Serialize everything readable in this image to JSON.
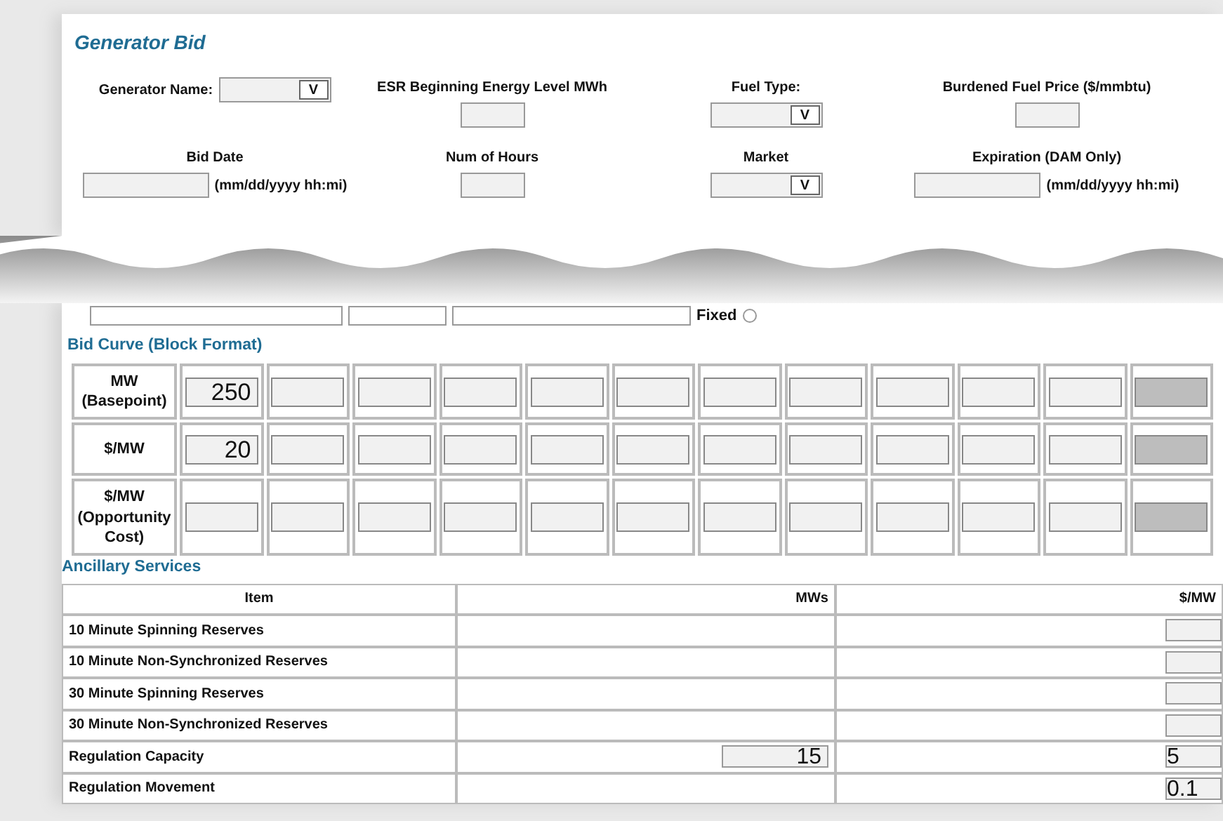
{
  "title": "Generator Bid",
  "field_rows": [
    [
      {
        "label": "Generator Name:",
        "kind": "inline-select",
        "button": "V"
      },
      {
        "label": "ESR Beginning Energy Level MWh",
        "kind": "text"
      },
      {
        "label": "Fuel Type:",
        "kind": "select",
        "button": "V"
      },
      {
        "label": "Burdened Fuel Price ($/mmbtu)",
        "kind": "text"
      }
    ],
    [
      {
        "label": "Bid Date",
        "kind": "text",
        "hint": "(mm/dd/yyyy hh:mi)"
      },
      {
        "label": "Num of Hours",
        "kind": "text"
      },
      {
        "label": "Market",
        "kind": "select",
        "button": "V"
      },
      {
        "label": "Expiration (DAM Only)",
        "kind": "text",
        "hint": "(mm/dd/yyyy hh:mi)"
      }
    ]
  ],
  "torn_strip": {
    "partial_label": "Fixed",
    "radio_selected": false
  },
  "bid_curve": {
    "title": "Bid Curve (Block Format)",
    "rows": [
      {
        "label": "MW (Basepoint)",
        "cells": [
          {
            "value": "250",
            "disabled": false
          },
          {
            "disabled": false
          },
          {
            "disabled": false
          },
          {
            "disabled": false
          },
          {
            "disabled": false
          },
          {
            "disabled": false
          },
          {
            "disabled": false
          },
          {
            "disabled": false
          },
          {
            "disabled": false
          },
          {
            "disabled": false
          },
          {
            "disabled": false
          },
          {
            "disabled": true
          }
        ]
      },
      {
        "label": "$/MW",
        "cells": [
          {
            "value": "20",
            "disabled": false
          },
          {
            "disabled": false
          },
          {
            "disabled": false
          },
          {
            "disabled": false
          },
          {
            "disabled": false
          },
          {
            "disabled": false
          },
          {
            "disabled": false
          },
          {
            "disabled": false
          },
          {
            "disabled": false
          },
          {
            "disabled": false
          },
          {
            "disabled": false
          },
          {
            "disabled": true
          }
        ]
      },
      {
        "label": "$/MW (Opportunity Cost)",
        "cells": [
          {
            "disabled": false
          },
          {
            "disabled": false
          },
          {
            "disabled": false
          },
          {
            "disabled": false
          },
          {
            "disabled": false
          },
          {
            "disabled": false
          },
          {
            "disabled": false
          },
          {
            "disabled": false
          },
          {
            "disabled": false
          },
          {
            "disabled": false
          },
          {
            "disabled": false
          },
          {
            "disabled": true
          }
        ]
      }
    ]
  },
  "ancillary": {
    "title": "Ancillary Services",
    "columns": [
      "Item",
      "MWs",
      "$/MW"
    ],
    "rows": [
      {
        "item": "10 Minute Spinning Reserves",
        "mw_field": false,
        "price_field": true
      },
      {
        "item": "10 Minute Non-Synchronized Reserves",
        "mw_field": false,
        "price_field": true
      },
      {
        "item": "30 Minute Spinning Reserves",
        "mw_field": false,
        "price_field": true
      },
      {
        "item": "30 Minute Non-Synchronized Reserves",
        "mw_field": false,
        "price_field": true
      },
      {
        "item": "Regulation Capacity",
        "mw_field": true,
        "mw": "15",
        "price_field": true,
        "price": "5"
      },
      {
        "item": "Regulation Movement",
        "mw_field": false,
        "price_field": true,
        "price": "0.1"
      }
    ]
  }
}
